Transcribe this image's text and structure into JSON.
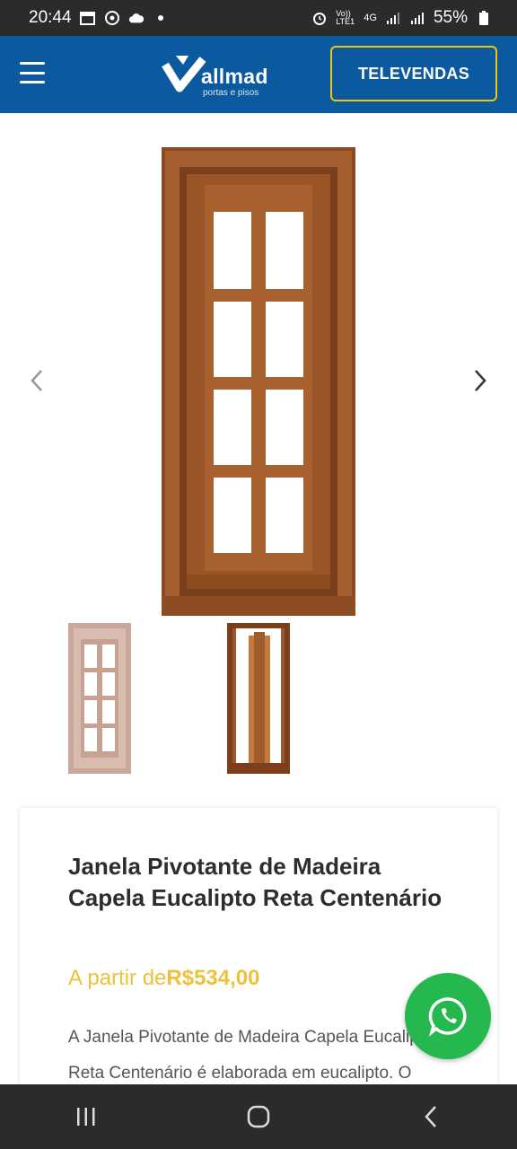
{
  "status": {
    "time": "20:44",
    "battery": "55%",
    "network": "4G"
  },
  "header": {
    "brand": "allmad",
    "tagline": "portas e pisos",
    "televendas_label": "TELEVENDAS",
    "colors": {
      "bg": "#0b5aa0",
      "accent": "#f1c40f"
    }
  },
  "product": {
    "title": "Janela Pivotante de Madeira Capela Eucalipto Reta Centenário",
    "price_prefix": "A partir de",
    "price_value": "R$534,00",
    "description": "A Janela Pivotante de Madeira Capela Eucalipto Reta Centenário é elaborada em eucalipto. O"
  },
  "icons": {
    "menu": "hamburger-icon",
    "prev": "chevron-left-icon",
    "next": "chevron-right-icon",
    "whatsapp": "whatsapp-icon",
    "recent": "recent-apps-icon",
    "home": "home-icon",
    "back": "back-icon"
  }
}
